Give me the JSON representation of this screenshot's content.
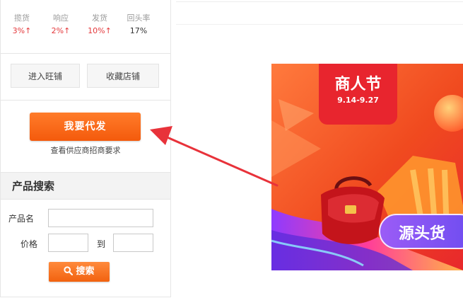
{
  "stats": [
    {
      "label": "揽货",
      "value": "3%↑",
      "color": "red"
    },
    {
      "label": "响应",
      "value": "2%↑",
      "color": "red"
    },
    {
      "label": "发货",
      "value": "10%↑",
      "color": "red"
    },
    {
      "label": "回头率",
      "value": "17%",
      "color": "dark"
    }
  ],
  "shop_buttons": {
    "enter_shop": "进入旺铺",
    "favorite_shop": "收藏店铺"
  },
  "cta": {
    "label": "我要代发",
    "sub": "查看供应商招商要求"
  },
  "product_search": {
    "title": "产品搜索",
    "name_label": "产品名",
    "name_value": "",
    "price_label": "价格",
    "price_min": "",
    "to_label": "到",
    "price_max": "",
    "search_label": "搜索"
  },
  "banner": {
    "title": "商人节",
    "dates": "9.14-9.27",
    "tagline": "源头货"
  },
  "colors": {
    "accent": "#f45a0c",
    "arrow": "#e8323a",
    "badge": "#e8252e"
  }
}
